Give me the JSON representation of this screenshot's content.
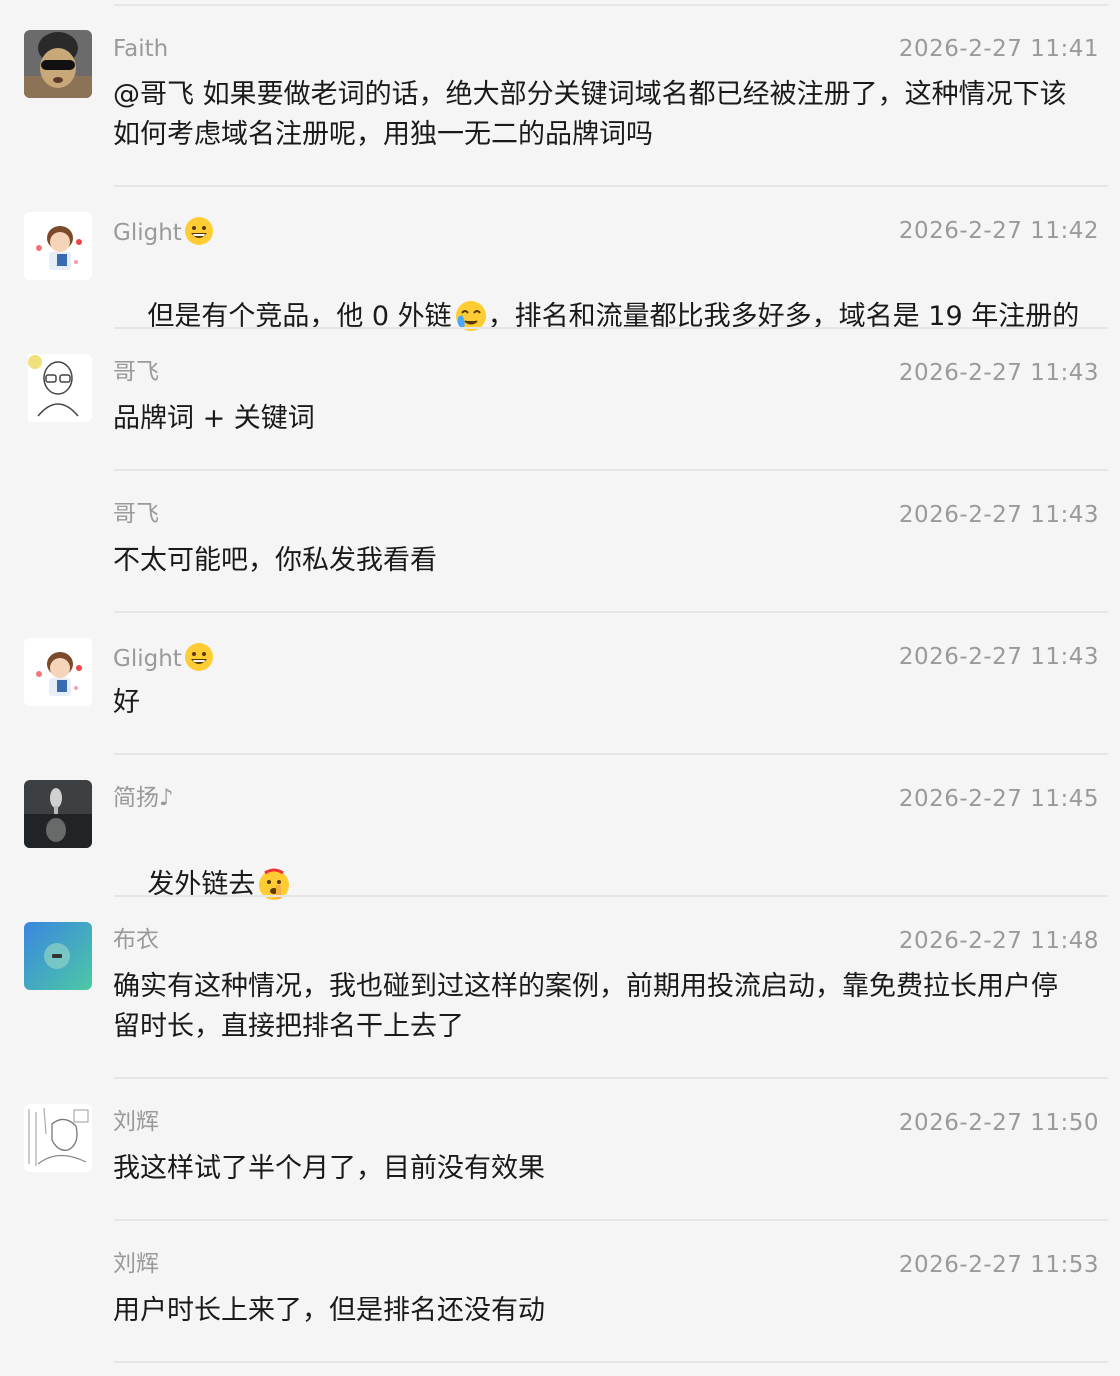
{
  "messages": [
    {
      "sender": "Faith",
      "time": "2026-2-27 11:41",
      "text": "@哥飞 如果要做老词的话，绝大部分关键词域名都已经被注册了，这种情况下该\n如何考虑域名注册呢，用独一无二的品牌词吗",
      "avatar": "sunglasses-avatar"
    },
    {
      "sender": "Glight",
      "time": "2026-2-27 11:42",
      "text_a": "但是有个竞品，他 0 外链",
      "text_b": "，排名和流量都比我多好多，域名是 19 年注册的",
      "avatar": "cartoon-boy-avatar",
      "sender_emoji": "grinning-face-icon",
      "text_emoji": "crying-face-icon"
    },
    {
      "sender": "哥飞",
      "time": "2026-2-27 11:43",
      "text": "品牌词 + 关键词",
      "avatar": "bald-glasses-avatar"
    },
    {
      "sender": "哥飞",
      "time": "2026-2-27 11:43",
      "text": "不太可能吧，你私发我看看"
    },
    {
      "sender": "Glight",
      "time": "2026-2-27 11:43",
      "text": "好",
      "avatar": "cartoon-boy-avatar",
      "sender_emoji": "grinning-face-icon"
    },
    {
      "sender": "简扬♪",
      "time": "2026-2-27 11:45",
      "text": "发外链去",
      "avatar": "tiger-reflection-avatar",
      "text_emoji": "shushing-face-icon"
    },
    {
      "sender": "布衣",
      "time": "2026-2-27 11:48",
      "text": "确实有这种情况，我也碰到过这样的案例，前期用投流启动，靠免费拉长用户停\n留时长，直接把排名干上去了",
      "avatar": "gradient-avatar"
    },
    {
      "sender": "刘辉",
      "time": "2026-2-27 11:50",
      "text": "我这样试了半个月了，目前没有效果",
      "avatar": "sketch-avatar"
    },
    {
      "sender": "刘辉",
      "time": "2026-2-27 11:53",
      "text": "用户时长上来了，但是排名还没有动"
    }
  ]
}
